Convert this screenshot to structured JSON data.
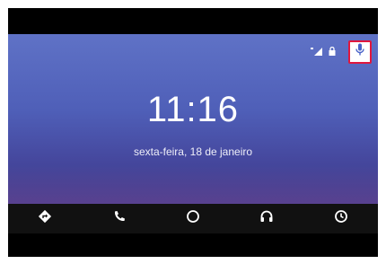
{
  "home": {
    "time": "11:16",
    "date": "sexta-feira, 18 de janeiro"
  },
  "status": {
    "icons": [
      "signal-icon",
      "lock-icon"
    ],
    "voice_button_icon": "microphone-icon",
    "highlight_color": "#e0173e"
  },
  "nav": {
    "items": [
      {
        "icon": "navigation-icon"
      },
      {
        "icon": "phone-icon"
      },
      {
        "icon": "home-circle-icon"
      },
      {
        "icon": "headphones-icon"
      },
      {
        "icon": "recents-icon"
      }
    ]
  },
  "colors": {
    "accent": "#5f72c6",
    "nav_background": "#111111"
  }
}
